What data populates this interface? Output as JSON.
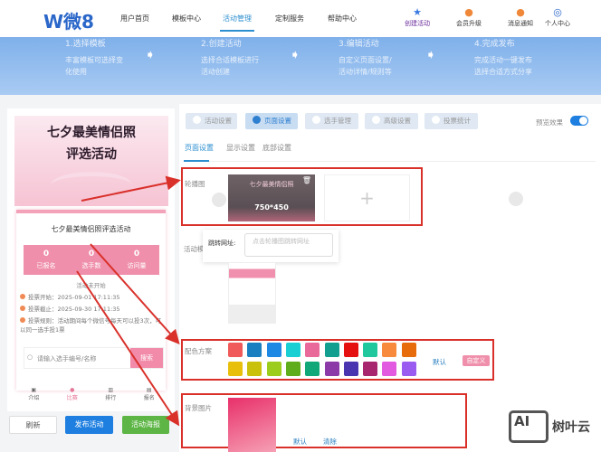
{
  "header": {
    "logo": "W微8",
    "nav": [
      "用户首页",
      "模板中心",
      "活动管理",
      "定制服务",
      "帮助中心"
    ],
    "active_nav": "活动管理",
    "actions": [
      {
        "label": "创建活动",
        "icon": "star-icon"
      },
      {
        "label": "会员升级",
        "icon": "medal-icon"
      },
      {
        "label": "消息通知",
        "icon": "bell-icon"
      },
      {
        "label": "个人中心",
        "icon": "user-icon"
      }
    ]
  },
  "banner": {
    "steps": [
      {
        "title": "1.选择模板",
        "desc": "丰富模板可选择变化使用"
      },
      {
        "title": "2.创建活动",
        "desc": "选择合适模板进行活动创建"
      },
      {
        "title": "3.编辑活动",
        "desc": "自定义页面设置/活动详情/规则等"
      },
      {
        "title": "4.完成发布",
        "desc": "完成活动一键发布选择合适方式分享"
      }
    ]
  },
  "preview": {
    "poster_title_1": "七夕最美情侣照",
    "poster_title_2": "评选活动",
    "card_title": "七夕最美情侣照评选活动",
    "stats": [
      {
        "value": "0",
        "label": "已报名"
      },
      {
        "value": "0",
        "label": "选手数"
      },
      {
        "value": "0",
        "label": "访问量"
      }
    ],
    "status": "活动未开始",
    "vote_start": "投票开始：2025-09-01 17:11:35",
    "vote_end": "投票截止：2025-09-30 17:11:35",
    "vote_rule": "投票规则：活动期间每个微信号每天可以投3次，可以同一选手投1票",
    "search_placeholder": "请输入选手编号/名称",
    "search_button": "搜索",
    "tabbar": [
      "介绍",
      "比赛",
      "排行",
      "报名"
    ],
    "buttons": {
      "refresh": "刷新",
      "publish": "发布活动",
      "poster": "活动海报"
    }
  },
  "settings": {
    "tabs": [
      "活动设置",
      "页面设置",
      "选手管理",
      "高级设置",
      "投票统计"
    ],
    "active_tab": "页面设置",
    "preview_label": "预览效果",
    "preview_on": true,
    "subtabs": [
      "页面设置",
      "显示设置",
      "底部设置"
    ],
    "active_subtab": "页面设置",
    "carousel": {
      "label": "轮播图",
      "image_size": "750*450"
    },
    "popup": {
      "label": "跳转网址:",
      "placeholder": "点击轮播图跳转网址"
    },
    "template": {
      "label": "活动模板"
    },
    "colors": {
      "label": "配色方案",
      "swatches": [
        "#f05a5a",
        "#1a7fc0",
        "#1e88e5",
        "#19cfd3",
        "#e96a9a",
        "#139f8f",
        "#e51010",
        "#21c79d",
        "#f88a3d",
        "#e76c0c",
        "#e8c00c",
        "#c9c10c",
        "#9ccd1d",
        "#5fac1c",
        "#10a878",
        "#8b3aa8",
        "#4a35b0",
        "#a8266e",
        "#e25ae0",
        "#9a5cf0"
      ],
      "default_label": "默认",
      "custom_label": "自定义"
    },
    "background": {
      "label": "背景图片",
      "default_label": "默认",
      "clear_label": "清除"
    }
  },
  "watermark": {
    "text": "树叶云",
    "logo": "AI"
  }
}
